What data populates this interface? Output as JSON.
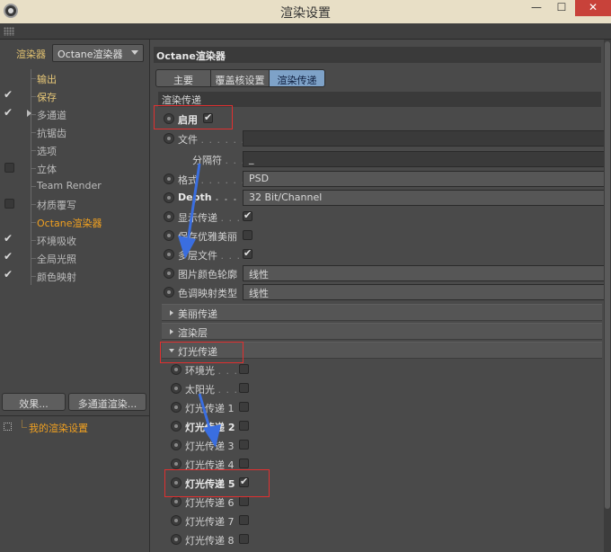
{
  "window": {
    "title": "渲染设置",
    "minimize": "—",
    "maximize": "☐",
    "close": "✕"
  },
  "left": {
    "renderer_label": "渲染器",
    "renderer_value": "Octane渲染器",
    "tree": [
      {
        "label": "输出",
        "check": "none",
        "style": "hl"
      },
      {
        "label": "保存",
        "check": "tick",
        "style": "hl"
      },
      {
        "label": "多通道",
        "check": "tick",
        "style": "normal",
        "expander": true
      },
      {
        "label": "抗锯齿",
        "check": "none",
        "style": "normal"
      },
      {
        "label": "选项",
        "check": "none",
        "style": "normal"
      },
      {
        "label": "立体",
        "check": "box",
        "style": "normal"
      },
      {
        "label": "Team Render",
        "check": "none",
        "style": "normal"
      },
      {
        "label": "材质覆写",
        "check": "box",
        "style": "normal"
      },
      {
        "label": "Octane渲染器",
        "check": "none",
        "style": "active"
      },
      {
        "label": "环境吸收",
        "check": "tick",
        "style": "normal"
      },
      {
        "label": "全局光照",
        "check": "tick",
        "style": "normal"
      },
      {
        "label": "颜色映射",
        "check": "tick",
        "style": "normal"
      }
    ],
    "effect_button": "效果...",
    "multipass_button": "多通道渲染...",
    "settings_item": "我的渲染设置"
  },
  "right": {
    "panel_title": "Octane渲染器",
    "tabs": {
      "main": "主要",
      "override": "覆盖核设置",
      "render_pass": "渲染传递"
    },
    "section": "渲染传递",
    "enable": {
      "label": "启用",
      "checked": true
    },
    "file": {
      "label": "文件",
      "dots": ". . . . . . .",
      "value": ""
    },
    "separator": {
      "label": "分隔符",
      "dots": ". . . . . .",
      "value": "_"
    },
    "format": {
      "label": "格式",
      "dots": ". . . . . . .",
      "value": "PSD"
    },
    "depth": {
      "label": "Depth",
      "dots": ". . . . . .",
      "value": "32 Bit/Channel"
    },
    "show_passes": {
      "label": "显示传递",
      "dots": ". . . .",
      "checked": true
    },
    "keep_beauty": {
      "label": "保存优雅美丽",
      "checked": false
    },
    "multilayer": {
      "label": "多层文件",
      "dots": ". . . .",
      "checked": true
    },
    "color_profile": {
      "label": "图片颜色轮廓",
      "value": "线性"
    },
    "tonemap_type": {
      "label": "色调映射类型",
      "value": "线性"
    },
    "group_beauty": "美丽传递",
    "group_render_layer": "渲染层",
    "group_light": "灯光传递",
    "light_items": [
      {
        "label": "环境光",
        "dots": ". . . .",
        "checked": false,
        "bold": false
      },
      {
        "label": "太阳光",
        "dots": ". . . .",
        "checked": false,
        "bold": false
      },
      {
        "label": "灯光传递 1",
        "dots": "",
        "checked": false,
        "bold": false
      },
      {
        "label": "灯光传递 2",
        "dots": "",
        "checked": false,
        "bold": true
      },
      {
        "label": "灯光传递 3",
        "dots": "",
        "checked": false,
        "bold": false
      },
      {
        "label": "灯光传递 4",
        "dots": "",
        "checked": false,
        "bold": false
      },
      {
        "label": "灯光传递 5",
        "dots": "",
        "checked": true,
        "bold": true
      },
      {
        "label": "灯光传递 6",
        "dots": "",
        "checked": false,
        "bold": false
      },
      {
        "label": "灯光传递 7",
        "dots": "",
        "checked": false,
        "bold": false
      },
      {
        "label": "灯光传递 8",
        "dots": "",
        "checked": false,
        "bold": false
      }
    ]
  },
  "colors": {
    "accent_orange": "#f0a020",
    "highlight_label": "#e8c878",
    "active_tab": "#7ea2c8",
    "annotation_red": "#e03030",
    "annotation_arrow": "#3a6ee0"
  }
}
